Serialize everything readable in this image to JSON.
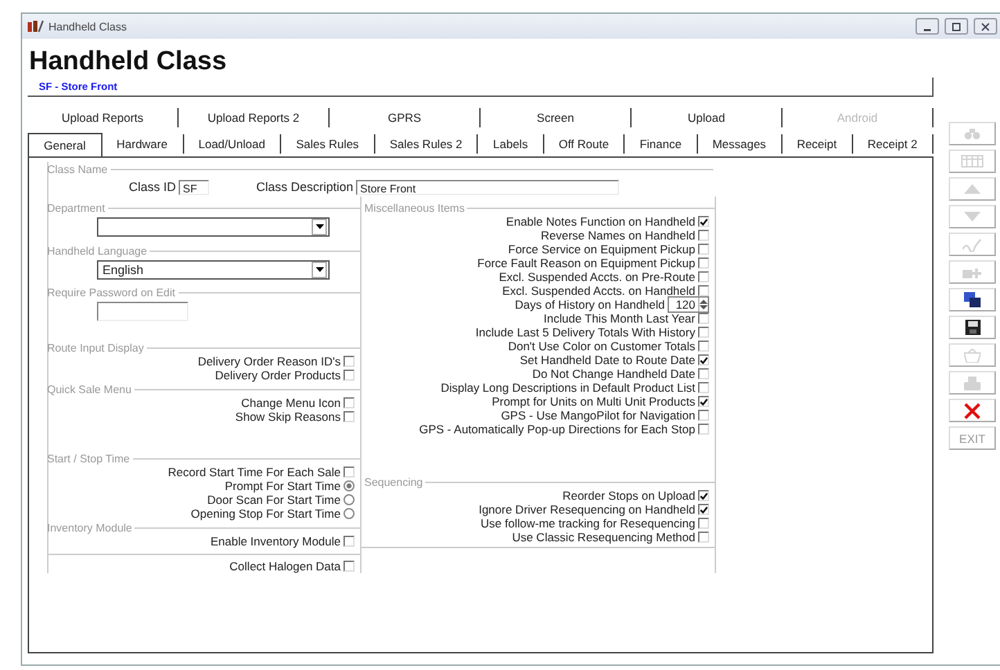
{
  "window": {
    "title": "Handheld Class"
  },
  "heading": "Handheld Class",
  "subtitle": "SF - Store Front",
  "tab_rows": [
    [
      {
        "label": "Upload Reports",
        "selected": false,
        "disabled": false
      },
      {
        "label": "Upload Reports 2",
        "selected": false,
        "disabled": false
      },
      {
        "label": "GPRS",
        "selected": false,
        "disabled": false
      },
      {
        "label": "Screen",
        "selected": false,
        "disabled": false
      },
      {
        "label": "Upload",
        "selected": false,
        "disabled": false
      },
      {
        "label": "Android",
        "selected": false,
        "disabled": true
      }
    ],
    [
      {
        "label": "General",
        "selected": true,
        "disabled": false
      },
      {
        "label": "Hardware",
        "selected": false,
        "disabled": false
      },
      {
        "label": "Load/Unload",
        "selected": false,
        "disabled": false
      },
      {
        "label": "Sales Rules",
        "selected": false,
        "disabled": false
      },
      {
        "label": "Sales Rules 2",
        "selected": false,
        "disabled": false
      },
      {
        "label": "Labels",
        "selected": false,
        "disabled": false
      },
      {
        "label": "Off Route",
        "selected": false,
        "disabled": false
      },
      {
        "label": "Finance",
        "selected": false,
        "disabled": false
      },
      {
        "label": "Messages",
        "selected": false,
        "disabled": false
      },
      {
        "label": "Receipt",
        "selected": false,
        "disabled": false
      },
      {
        "label": "Receipt 2",
        "selected": false,
        "disabled": false
      }
    ]
  ],
  "class_name": {
    "title": "Class Name",
    "id_label": "Class ID",
    "id_value": "SF",
    "description_label": "Class Description",
    "description_value": "Store Front"
  },
  "left_groups": [
    {
      "title": "Department",
      "items": [
        {
          "kind": "dropdown",
          "value": ""
        }
      ]
    },
    {
      "title": "Handheld Language",
      "items": [
        {
          "kind": "dropdown",
          "value": "English"
        }
      ]
    },
    {
      "title": "Require Password on Edit",
      "items": [
        {
          "kind": "field",
          "value": ""
        }
      ]
    },
    {
      "title": "Route Input Display",
      "items": [
        {
          "kind": "checkbox",
          "label": "Delivery Order Reason ID's",
          "checked": false
        },
        {
          "kind": "checkbox",
          "label": "Delivery Order Products",
          "checked": false
        }
      ]
    },
    {
      "title": "Quick Sale Menu",
      "items": [
        {
          "kind": "checkbox",
          "label": "Change Menu Icon",
          "checked": false
        },
        {
          "kind": "checkbox",
          "label": "Show Skip Reasons",
          "checked": false
        }
      ]
    },
    {
      "title": "Start / Stop Time",
      "items": [
        {
          "kind": "checkbox",
          "label": "Record Start Time For Each Sale",
          "checked": false
        },
        {
          "kind": "radio",
          "label": "Prompt For Start Time",
          "selected": true
        },
        {
          "kind": "radio",
          "label": "Door Scan For Start Time",
          "selected": false
        },
        {
          "kind": "radio",
          "label": "Opening Stop For Start Time",
          "selected": false
        }
      ]
    },
    {
      "title": "Inventory Module",
      "items": [
        {
          "kind": "checkbox",
          "label": "Enable Inventory Module",
          "checked": false
        }
      ]
    },
    {
      "items": [
        {
          "kind": "checkbox",
          "label": "Collect Halogen Data",
          "checked": false
        }
      ]
    }
  ],
  "right_groups": [
    {
      "title": "Miscellaneous Items",
      "items": [
        {
          "kind": "checkbox",
          "label": "Enable Notes Function on Handheld",
          "checked": true
        },
        {
          "kind": "checkbox",
          "label": "Reverse Names on Handheld",
          "checked": false
        },
        {
          "kind": "checkbox",
          "label": "Force Service on Equipment Pickup",
          "checked": false
        },
        {
          "kind": "checkbox",
          "label": "Force Fault Reason on Equipment Pickup",
          "checked": false
        },
        {
          "kind": "checkbox",
          "label": "Excl. Suspended Accts. on Pre-Route",
          "checked": false
        },
        {
          "kind": "checkbox",
          "label": "Excl. Suspended Accts. on Handheld",
          "checked": false
        },
        {
          "kind": "spin",
          "label": "Days of History on Handheld",
          "value": "120"
        },
        {
          "kind": "checkbox",
          "label": "Include This Month Last Year",
          "checked": false
        },
        {
          "kind": "checkbox",
          "label": "Include Last 5 Delivery Totals With History",
          "checked": false
        },
        {
          "kind": "checkbox",
          "label": "Don't Use Color on Customer Totals",
          "checked": false
        },
        {
          "kind": "checkbox",
          "label": "Set Handheld Date to Route Date",
          "checked": true
        },
        {
          "kind": "checkbox",
          "label": "Do Not Change Handheld Date",
          "checked": false
        },
        {
          "kind": "checkbox",
          "label": "Display Long Descriptions in Default Product List",
          "checked": false
        },
        {
          "kind": "checkbox",
          "label": "Prompt for Units on Multi Unit Products",
          "checked": true
        },
        {
          "kind": "checkbox",
          "label": "GPS - Use MangoPilot for Navigation",
          "checked": false
        },
        {
          "kind": "checkbox",
          "label": "GPS - Automatically Pop-up Directions for Each Stop",
          "checked": false
        }
      ]
    },
    {
      "title": "Sequencing",
      "items": [
        {
          "kind": "checkbox",
          "label": "Reorder Stops on Upload",
          "checked": true
        },
        {
          "kind": "checkbox",
          "label": "Ignore Driver Resequencing on Handheld",
          "checked": true
        },
        {
          "kind": "checkbox",
          "label": "Use follow-me tracking for Resequencing",
          "checked": false
        },
        {
          "kind": "checkbox",
          "label": "Use Classic Resequencing Method",
          "checked": false
        }
      ]
    }
  ],
  "toolbar": [
    {
      "kind": "binoculars",
      "disabled": true
    },
    {
      "kind": "grid",
      "disabled": true
    },
    {
      "kind": "up",
      "disabled": true
    },
    {
      "kind": "down",
      "disabled": true
    },
    {
      "kind": "signature",
      "disabled": true
    },
    {
      "kind": "add",
      "disabled": true
    },
    {
      "kind": "copy",
      "disabled": false
    },
    {
      "kind": "save",
      "disabled": false
    },
    {
      "kind": "basket",
      "disabled": true
    },
    {
      "kind": "print",
      "disabled": true
    },
    {
      "kind": "close",
      "disabled": false
    },
    {
      "kind": "text",
      "label": "EXIT",
      "disabled": true
    }
  ]
}
